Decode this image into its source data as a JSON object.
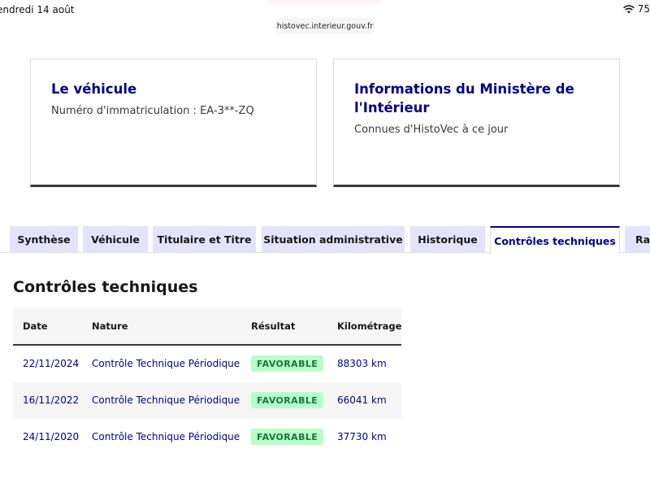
{
  "status_bar": {
    "date": "endredi 14 août",
    "battery": "75"
  },
  "browser": {
    "url": "histovec.interieur.gouv.fr"
  },
  "cards": [
    {
      "title": "Le véhicule",
      "text": "Numéro d'immatriculation : EA-3**-ZQ"
    },
    {
      "title": "Informations du Ministère de l'Intérieur",
      "text": "Connues d'HistoVec à ce jour"
    }
  ],
  "tabs": [
    {
      "label": "Synthèse"
    },
    {
      "label": "Véhicule"
    },
    {
      "label": "Titulaire et Titre"
    },
    {
      "label": "Situation administrative"
    },
    {
      "label": "Historique"
    },
    {
      "label": "Contrôles techniques"
    },
    {
      "label": "Rap"
    }
  ],
  "active_tab": "Contrôles techniques",
  "section": {
    "title": "Contrôles techniques",
    "columns": [
      "Date",
      "Nature",
      "Résultat",
      "Kilométrage"
    ],
    "rows": [
      {
        "date": "22/11/2024",
        "nature": "Contrôle Technique Périodique",
        "result": "FAVORABLE",
        "km": "88303 km"
      },
      {
        "date": "16/11/2022",
        "nature": "Contrôle Technique Périodique",
        "result": "FAVORABLE",
        "km": "66041 km"
      },
      {
        "date": "24/11/2020",
        "nature": "Contrôle Technique Périodique",
        "result": "FAVORABLE",
        "km": "37730 km"
      }
    ]
  },
  "colors": {
    "brand_blue": "#000091",
    "tab_bg": "#e3e3fd",
    "success_bg": "#b8fec9",
    "success_text": "#18753c"
  }
}
